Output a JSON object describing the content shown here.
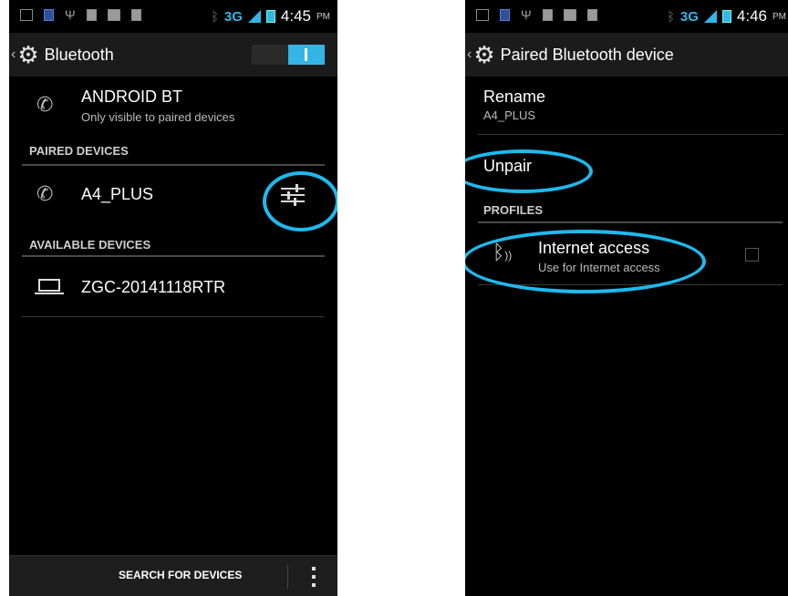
{
  "left_screen": {
    "status_bar": {
      "time": "4:45",
      "ampm": "PM",
      "network": "3G"
    },
    "action_bar": {
      "title": "Bluetooth"
    },
    "device": {
      "name": "ANDROID BT",
      "visibility": "Only visible to paired devices"
    },
    "paired_header": "PAIRED DEVICES",
    "paired_devices": [
      {
        "name": "A4_PLUS"
      }
    ],
    "available_header": "AVAILABLE DEVICES",
    "available_devices": [
      {
        "name": "ZGC-20141118RTR"
      }
    ],
    "bottom_bar": {
      "search_label": "SEARCH FOR DEVICES"
    }
  },
  "right_screen": {
    "status_bar": {
      "time": "4:46",
      "ampm": "PM",
      "network": "3G"
    },
    "action_bar": {
      "title": "Paired Bluetooth device"
    },
    "rename": {
      "label": "Rename",
      "value": "A4_PLUS"
    },
    "unpair_label": "Unpair",
    "profiles_header": "PROFILES",
    "profiles": [
      {
        "title": "Internet access",
        "summary": "Use for Internet access",
        "checked": false
      }
    ]
  },
  "accent_color": "#33b5e5",
  "highlight_color": "#1fb9ee",
  "icons": [
    "settings-gear-icon",
    "phone-icon",
    "laptop-icon",
    "device-settings-icon",
    "bluetooth-icon",
    "overflow-menu-icon"
  ]
}
